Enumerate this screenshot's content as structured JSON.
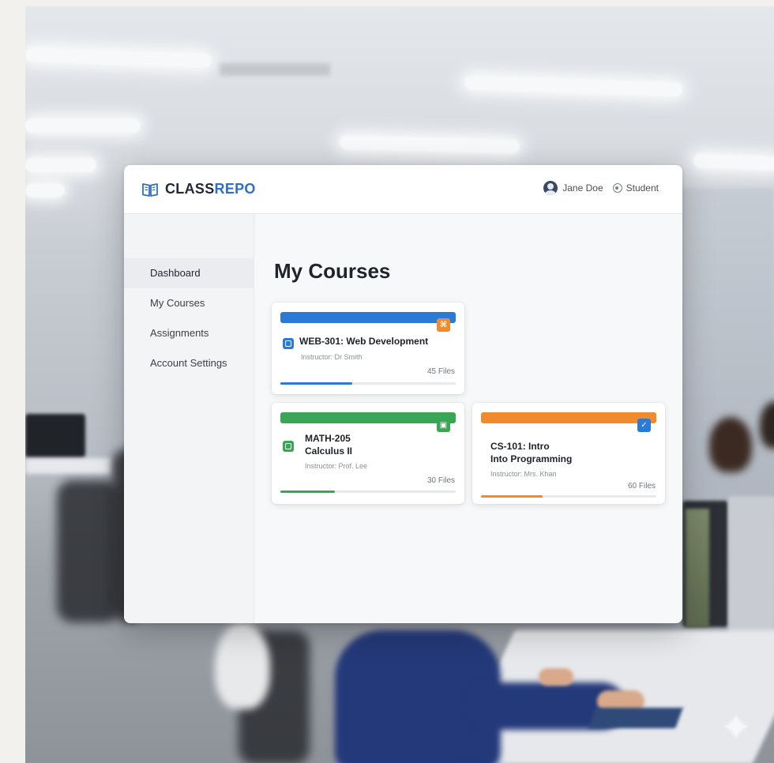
{
  "brand": {
    "part1": "CLASS",
    "part2": "REPO"
  },
  "user": {
    "name": "Jane Doe",
    "role": "Student"
  },
  "sidebar": {
    "items": [
      {
        "label": "Dashboard",
        "active": true
      },
      {
        "label": "My Courses",
        "active": false
      },
      {
        "label": "Assignments",
        "active": false
      },
      {
        "label": "Account Settings",
        "active": false
      }
    ]
  },
  "main": {
    "title": "My Courses"
  },
  "courses": [
    {
      "title_line1": "WEB-301: Web Development",
      "title_line2": "",
      "instructor": "Instructor: Dr Smith",
      "files": "45 Files",
      "color": "#2b7bd6",
      "badge_color": "#f08a2c",
      "icon_color": "#2b7bd6",
      "progress": 0.41
    },
    {
      "title_line1": "MATH-205",
      "title_line2": "Calculus II",
      "instructor": "Instructor: Prof. Lee",
      "files": "30 Files",
      "color": "#3aa655",
      "badge_color": "#3aa655",
      "icon_color": "#3aa655",
      "progress": 0.31
    },
    {
      "title_line1": "CS-101: Intro",
      "title_line2": "Into Programming",
      "instructor": "Instructor: Mrs. Khan",
      "files": "60 Files",
      "color": "#f08a2c",
      "badge_color": "#2b7bd6",
      "icon_color": "#f08a2c",
      "progress": 0.35
    }
  ]
}
